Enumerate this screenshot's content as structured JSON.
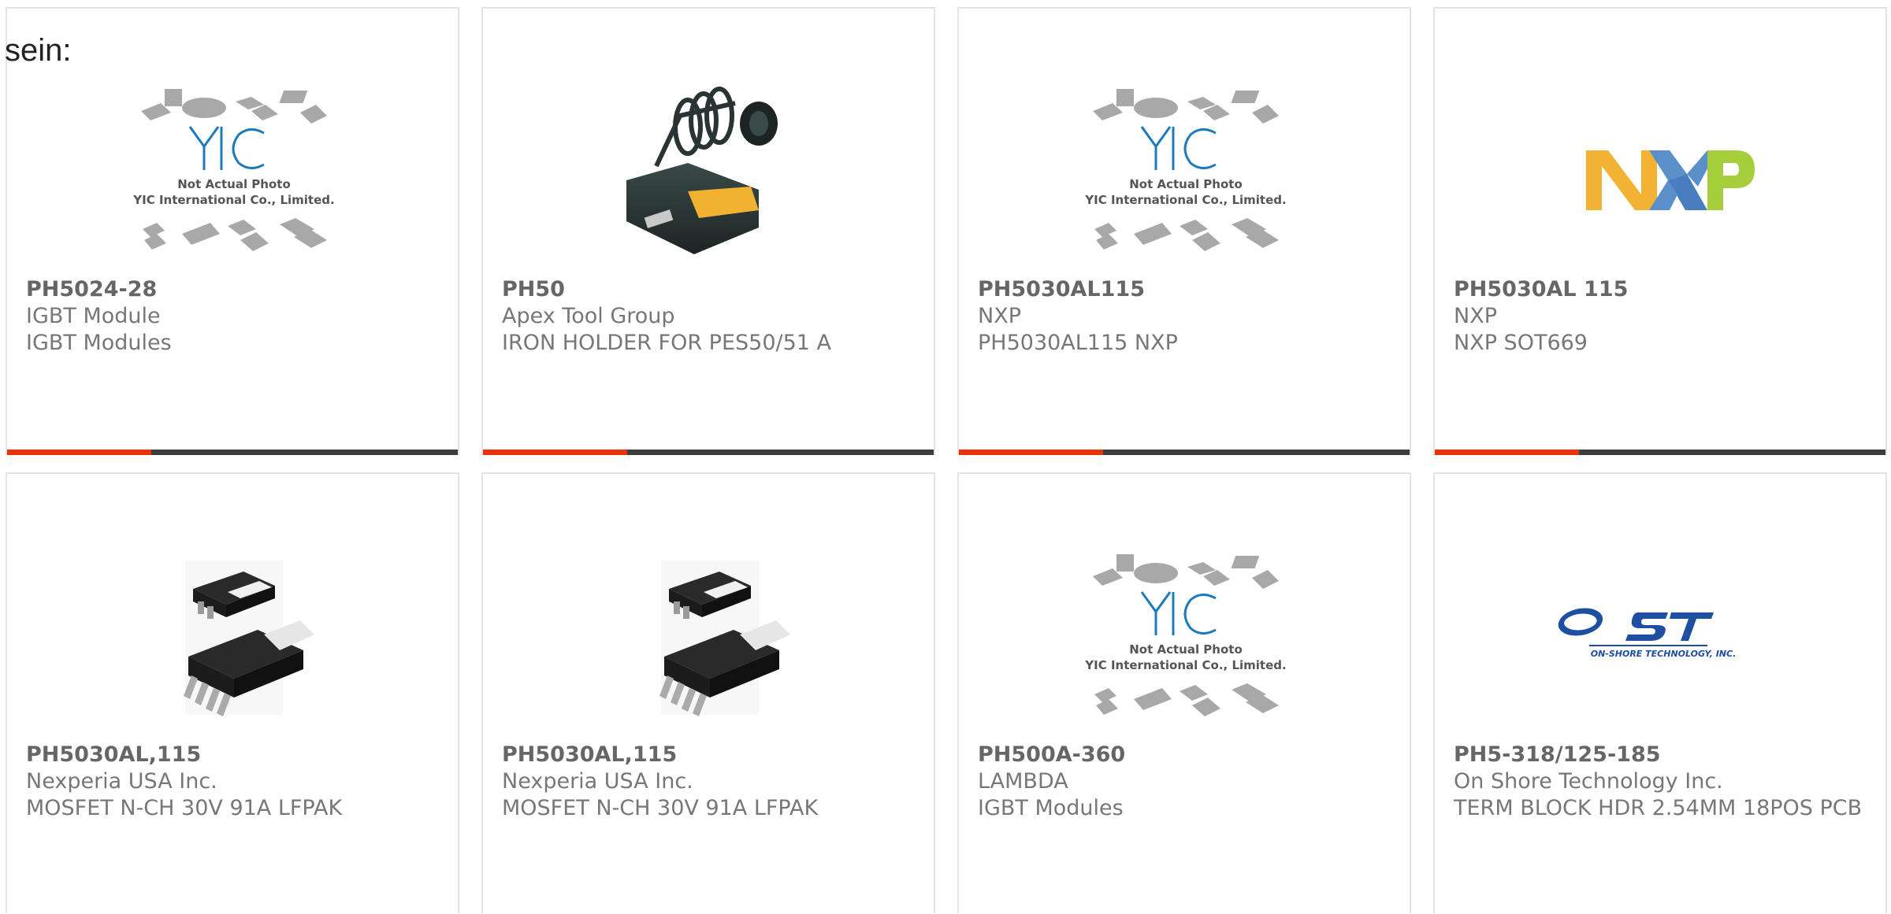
{
  "lead_text": "sein:",
  "cards": [
    {
      "part": "PH5024-28",
      "maker": "IGBT Module",
      "desc": "IGBT Modules",
      "image": "yic-placeholder",
      "placeholder": {
        "line1": "Not Actual Photo",
        "line2": "YIC International Co., Limited."
      }
    },
    {
      "part": "PH50",
      "maker": "Apex Tool Group",
      "desc": "IRON HOLDER FOR PES50/51 A",
      "image": "soldering-iron-holder"
    },
    {
      "part": "PH5030AL115",
      "maker": "NXP",
      "desc": "PH5030AL115 NXP",
      "image": "yic-placeholder",
      "placeholder": {
        "line1": "Not Actual Photo",
        "line2": "YIC International Co., Limited."
      }
    },
    {
      "part": "PH5030AL 115",
      "maker": "NXP",
      "desc": "NXP SOT669",
      "image": "nxp-logo"
    },
    {
      "part": "PH5030AL,115",
      "maker": "Nexperia USA Inc.",
      "desc": "MOSFET N-CH 30V 91A LFPAK",
      "image": "lfpak-package"
    },
    {
      "part": "PH5030AL,115",
      "maker": "Nexperia USA Inc.",
      "desc": "MOSFET N-CH 30V 91A LFPAK",
      "image": "lfpak-package"
    },
    {
      "part": "PH500A-360",
      "maker": "LAMBDA",
      "desc": "IGBT Modules",
      "image": "yic-placeholder",
      "placeholder": {
        "line1": "Not Actual Photo",
        "line2": "YIC International Co., Limited."
      }
    },
    {
      "part": "PH5-318/125-185",
      "maker": "On Shore Technology Inc.",
      "desc": "TERM BLOCK HDR 2.54MM 18POS PCB",
      "image": "ost-logo",
      "logo_text": "ON-SHORE TECHNOLOGY, INC."
    }
  ],
  "colors": {
    "accent": "#e8330a",
    "bar": "#3d3d3d",
    "border": "#e3e3e3",
    "text": "#777777"
  }
}
